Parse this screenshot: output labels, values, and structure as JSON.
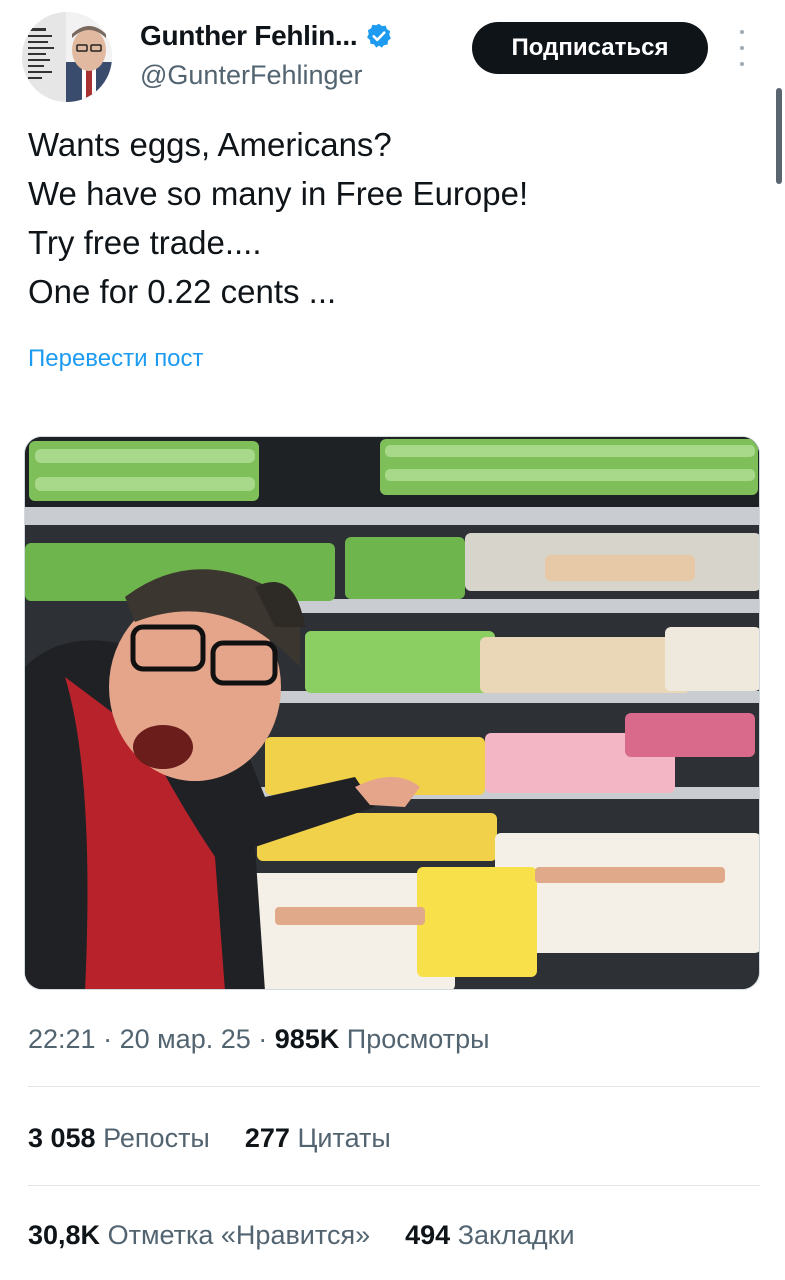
{
  "author": {
    "display_name": "Gunther Fehlin...",
    "handle": "@GunterFehlinger",
    "verified": true
  },
  "follow_button_label": "Подписаться",
  "more_icon": "more-vertical-icon",
  "post": {
    "lines": [
      "Wants eggs, Americans?",
      "We have so many in Free Europe!",
      "Try free trade....",
      "One for 0.22 cents ..."
    ],
    "translate_label": "Перевести пост"
  },
  "meta": {
    "time": "22:21",
    "sep1": " · ",
    "date": "20 мар. 25",
    "sep2": " · ",
    "views_count": "985K",
    "views_label": " Просмотры"
  },
  "stats": {
    "reposts": {
      "count": "3 058",
      "label": "Репосты"
    },
    "quotes": {
      "count": "277",
      "label": "Цитаты"
    },
    "likes": {
      "count": "30,8K",
      "label": "Отметка «Нравится»"
    },
    "bookmarks": {
      "count": "494",
      "label": "Закладки"
    }
  },
  "colors": {
    "accent": "#1d9bf0",
    "text_primary": "#0f1419",
    "text_secondary": "#536471",
    "button_bg": "#0f1419"
  }
}
